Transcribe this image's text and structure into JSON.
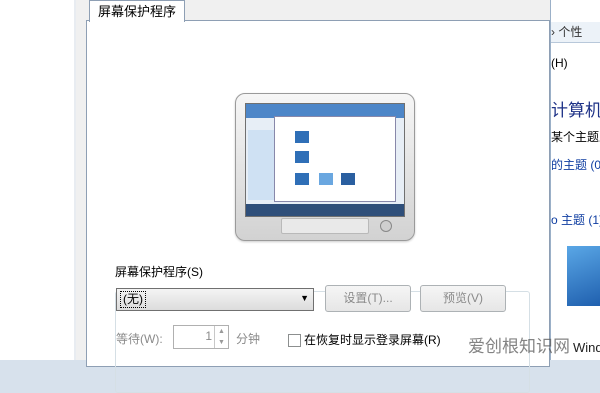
{
  "dialog": {
    "tab_label": "屏幕保护程序",
    "group_title": "屏幕保护程序(S)",
    "select_value": "(无)",
    "settings_button": "设置(T)...",
    "preview_button": "预览(V)",
    "wait_label": "等待(W):",
    "wait_value": "1",
    "minutes_label": "分钟",
    "resume_checkbox_label": "在恢复时显示登录屏幕(R)"
  },
  "right_window": {
    "address_fragment": "› 个性",
    "menu_help": "(H)",
    "title_fragment": "计算机",
    "text1": "某个主题立",
    "my_themes": "的主题 (0)",
    "aero_themes": "o 主题 (1)",
    "windows_fragment": "Wind"
  },
  "watermark": "爱创根知识网"
}
